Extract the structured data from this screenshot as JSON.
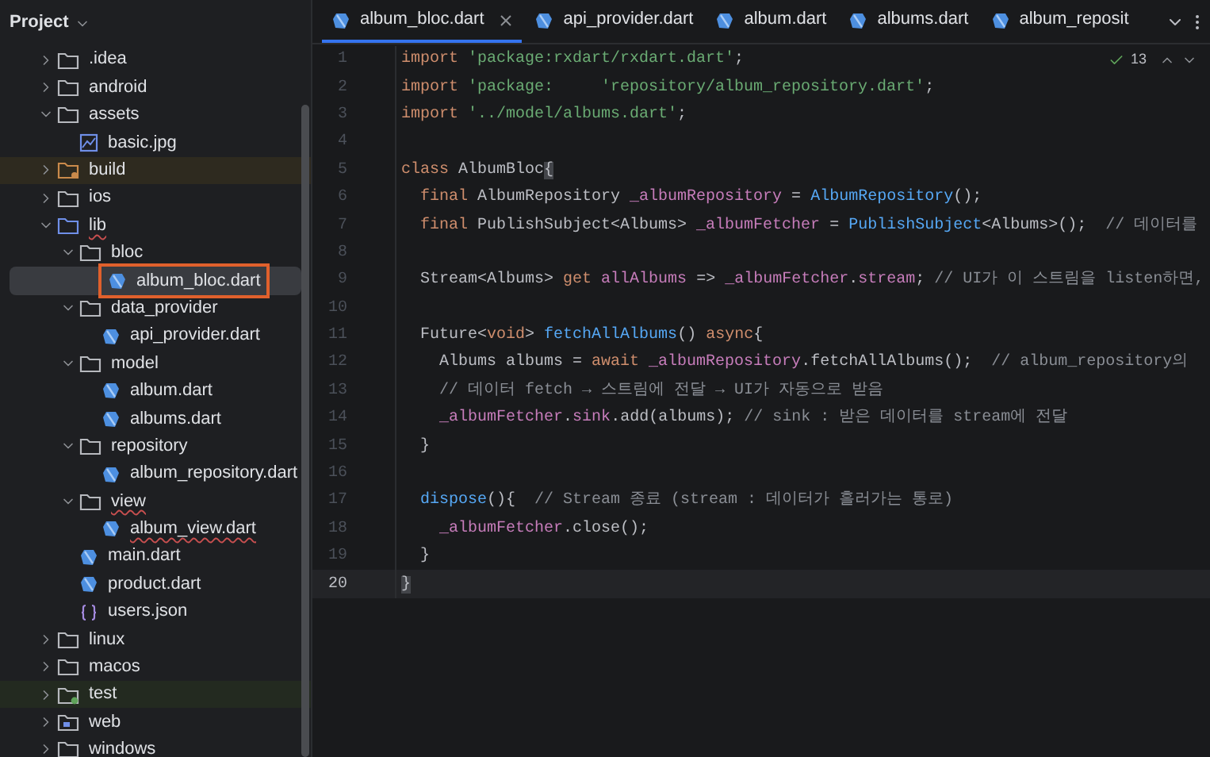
{
  "sidebar": {
    "title": "Project",
    "tree": [
      {
        "name": ".idea",
        "kind": "folder",
        "expanded": false,
        "selected": false,
        "warning": false
      },
      {
        "name": "android",
        "kind": "folder",
        "expanded": false,
        "selected": false,
        "warning": false
      },
      {
        "name": "assets",
        "kind": "folder",
        "expanded": true,
        "selected": false,
        "warning": false,
        "children": [
          {
            "name": "basic.jpg",
            "kind": "image",
            "selected": false,
            "warning": false
          }
        ]
      },
      {
        "name": "build",
        "kind": "excluded",
        "expanded": false,
        "selected": false,
        "warning": false
      },
      {
        "name": "ios",
        "kind": "folder",
        "expanded": false,
        "selected": false,
        "warning": false
      },
      {
        "name": "lib",
        "kind": "source",
        "expanded": true,
        "selected": false,
        "warning": true,
        "children": [
          {
            "name": "bloc",
            "kind": "folder",
            "expanded": true,
            "selected": false,
            "warning": false,
            "children": [
              {
                "name": "album_bloc.dart",
                "kind": "dart",
                "selected": true,
                "warning": false
              }
            ]
          },
          {
            "name": "data_provider",
            "kind": "folder",
            "expanded": true,
            "selected": false,
            "warning": false,
            "children": [
              {
                "name": "api_provider.dart",
                "kind": "dart",
                "selected": false,
                "warning": false
              }
            ]
          },
          {
            "name": "model",
            "kind": "folder",
            "expanded": true,
            "selected": false,
            "warning": false,
            "children": [
              {
                "name": "album.dart",
                "kind": "dart",
                "selected": false,
                "warning": false
              },
              {
                "name": "albums.dart",
                "kind": "dart",
                "selected": false,
                "warning": false
              }
            ]
          },
          {
            "name": "repository",
            "kind": "folder",
            "expanded": true,
            "selected": false,
            "warning": false,
            "children": [
              {
                "name": "album_repository.dart",
                "kind": "dart",
                "selected": false,
                "warning": false
              }
            ]
          },
          {
            "name": "view",
            "kind": "folder",
            "expanded": true,
            "selected": false,
            "warning": true,
            "children": [
              {
                "name": "album_view.dart",
                "kind": "dart",
                "selected": false,
                "warning": true
              }
            ]
          },
          {
            "name": "main.dart",
            "kind": "dart",
            "selected": false,
            "warning": false
          },
          {
            "name": "product.dart",
            "kind": "dart",
            "selected": false,
            "warning": false
          },
          {
            "name": "users.json",
            "kind": "json",
            "selected": false,
            "warning": false
          }
        ]
      },
      {
        "name": "linux",
        "kind": "folder",
        "expanded": false,
        "selected": false,
        "warning": false
      },
      {
        "name": "macos",
        "kind": "folder",
        "expanded": false,
        "selected": false,
        "warning": false
      },
      {
        "name": "test",
        "kind": "test",
        "expanded": false,
        "selected": false,
        "warning": false
      },
      {
        "name": "web",
        "kind": "web",
        "expanded": false,
        "selected": false,
        "warning": false
      },
      {
        "name": "windows",
        "kind": "folder",
        "expanded": false,
        "selected": false,
        "warning": false
      }
    ]
  },
  "tabs": [
    {
      "label": "album_bloc.dart",
      "selected": true
    },
    {
      "label": "api_provider.dart",
      "selected": false
    },
    {
      "label": "album.dart",
      "selected": false
    },
    {
      "label": "albums.dart",
      "selected": false
    },
    {
      "label": "album_reposit",
      "selected": false
    }
  ],
  "editor": {
    "inspections": "13",
    "lines": [
      {
        "no": "1",
        "current": false,
        "tokens": [
          {
            "kind": "kw",
            "t": "import "
          },
          {
            "kind": "str",
            "t": "'package:rxdart/rxdart.dart'"
          },
          {
            "kind": "plain",
            "t": ";"
          }
        ]
      },
      {
        "no": "2",
        "current": false,
        "tokens": [
          {
            "kind": "kw",
            "t": "import "
          },
          {
            "kind": "str",
            "t": "'package:     'repository/album_repository.dart'"
          },
          {
            "kind": "plain",
            "t": ";"
          }
        ]
      },
      {
        "no": "3",
        "current": false,
        "tokens": [
          {
            "kind": "kw",
            "t": "import "
          },
          {
            "kind": "str",
            "t": "'../model/albums.dart'"
          },
          {
            "kind": "plain",
            "t": ";"
          }
        ]
      },
      {
        "no": "4",
        "current": false
      },
      {
        "no": "5",
        "current": false,
        "tokens": [
          {
            "kind": "kw",
            "t": "class "
          },
          {
            "kind": "plain",
            "t": "AlbumBloc"
          },
          {
            "kind": "match",
            "t": "{"
          }
        ]
      },
      {
        "no": "6",
        "current": false,
        "tokens": [
          {
            "kind": "kw",
            "t": "  final "
          },
          {
            "kind": "plain",
            "t": "AlbumRepository "
          },
          {
            "kind": "field",
            "t": "_albumRepository"
          },
          {
            "kind": "plain",
            "t": " = "
          },
          {
            "kind": "fn",
            "t": "AlbumRepository"
          },
          {
            "kind": "plain",
            "t": "();"
          }
        ]
      },
      {
        "no": "7",
        "current": false,
        "tokens": [
          {
            "kind": "kw",
            "t": "  final "
          },
          {
            "kind": "plain",
            "t": "PublishSubject<Albums> "
          },
          {
            "kind": "field",
            "t": "_albumFetcher"
          },
          {
            "kind": "plain",
            "t": " = "
          },
          {
            "kind": "fn",
            "t": "PublishSubject"
          },
          {
            "kind": "plain",
            "t": "<Albums>();  "
          },
          {
            "kind": "comment",
            "t": "// 데이터를"
          }
        ]
      },
      {
        "no": "8",
        "current": false
      },
      {
        "no": "9",
        "current": false,
        "tokens": [
          {
            "kind": "plain",
            "t": "  Stream<Albums> "
          },
          {
            "kind": "kw",
            "t": "get "
          },
          {
            "kind": "field",
            "t": "allAlbums"
          },
          {
            "kind": "plain",
            "t": " => "
          },
          {
            "kind": "field",
            "t": "_albumFetcher"
          },
          {
            "kind": "plain",
            "t": "."
          },
          {
            "kind": "field",
            "t": "stream"
          },
          {
            "kind": "plain",
            "t": "; "
          },
          {
            "kind": "comment",
            "t": "// UI가 이 스트림을 listen하면,"
          }
        ]
      },
      {
        "no": "10",
        "current": false
      },
      {
        "no": "11",
        "current": false,
        "tokens": [
          {
            "kind": "plain",
            "t": "  Future<"
          },
          {
            "kind": "kw",
            "t": "void"
          },
          {
            "kind": "plain",
            "t": "> "
          },
          {
            "kind": "fn",
            "t": "fetchAllAlbums"
          },
          {
            "kind": "plain",
            "t": "() "
          },
          {
            "kind": "kw",
            "t": "async"
          },
          {
            "kind": "plain",
            "t": "{"
          }
        ]
      },
      {
        "no": "12",
        "current": false,
        "tokens": [
          {
            "kind": "plain",
            "t": "    Albums albums = "
          },
          {
            "kind": "kw",
            "t": "await "
          },
          {
            "kind": "field",
            "t": "_albumRepository"
          },
          {
            "kind": "plain",
            "t": ".fetchAllAlbums();  "
          },
          {
            "kind": "comment",
            "t": "// album_repository의"
          }
        ]
      },
      {
        "no": "13",
        "current": false,
        "tokens": [
          {
            "kind": "comment",
            "t": "    // 데이터 fetch → 스트림에 전달 → UI가 자동으로 받음"
          }
        ]
      },
      {
        "no": "14",
        "current": false,
        "tokens": [
          {
            "kind": "field",
            "t": "    _albumFetcher"
          },
          {
            "kind": "plain",
            "t": "."
          },
          {
            "kind": "field",
            "t": "sink"
          },
          {
            "kind": "plain",
            "t": ".add(albums); "
          },
          {
            "kind": "comment",
            "t": "// sink : 받은 데이터를 stream에 전달"
          }
        ]
      },
      {
        "no": "15",
        "current": false,
        "tokens": [
          {
            "kind": "plain",
            "t": "  }"
          }
        ]
      },
      {
        "no": "16",
        "current": false
      },
      {
        "no": "17",
        "current": false,
        "tokens": [
          {
            "kind": "fn",
            "t": "  dispose"
          },
          {
            "kind": "plain",
            "t": "(){  "
          },
          {
            "kind": "comment",
            "t": "// Stream 종료 (stream : 데이터가 흘러가는 통로)"
          }
        ]
      },
      {
        "no": "18",
        "current": false,
        "tokens": [
          {
            "kind": "field",
            "t": "    _albumFetcher"
          },
          {
            "kind": "plain",
            "t": ".close();"
          }
        ]
      },
      {
        "no": "19",
        "current": false,
        "tokens": [
          {
            "kind": "plain",
            "t": "  }"
          }
        ]
      },
      {
        "no": "20",
        "current": true,
        "tokens": [
          {
            "kind": "match",
            "t": "}"
          }
        ]
      }
    ]
  }
}
